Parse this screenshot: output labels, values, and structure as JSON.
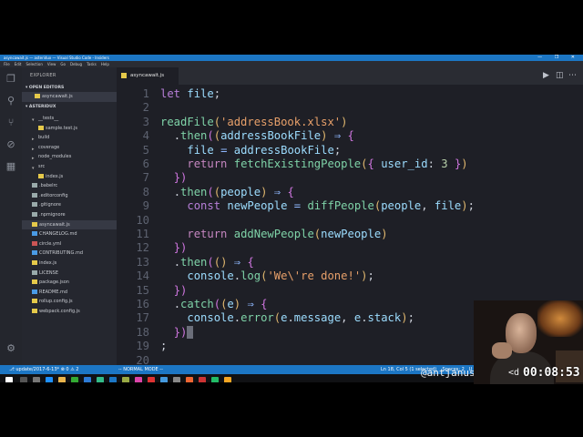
{
  "window": {
    "title": "asyncawait.js — asteridux — Visual Studio Code - Insiders",
    "controls": "— ❐ ✕"
  },
  "menu": [
    "File",
    "Edit",
    "Selection",
    "View",
    "Go",
    "Debug",
    "Tasks",
    "Help"
  ],
  "sidebar": {
    "title": "EXPLORER",
    "open_editors_label": "OPEN EDITORS",
    "open_editors": [
      "asyncawait.js"
    ],
    "project_label": "ASTERIDUX",
    "tree": [
      {
        "label": "__tests__",
        "depth": 1,
        "type": "folder",
        "open": true
      },
      {
        "label": "sample.test.js",
        "depth": 2,
        "type": "file"
      },
      {
        "label": "build",
        "depth": 1,
        "type": "folder",
        "open": false
      },
      {
        "label": "coverage",
        "depth": 1,
        "type": "folder",
        "open": false
      },
      {
        "label": "node_modules",
        "depth": 1,
        "type": "folder",
        "open": false
      },
      {
        "label": "src",
        "depth": 1,
        "type": "folder",
        "open": true
      },
      {
        "label": "index.js",
        "depth": 2,
        "type": "file"
      },
      {
        "label": ".babelrc",
        "depth": 1,
        "type": "file"
      },
      {
        "label": ".editorconfig",
        "depth": 1,
        "type": "file"
      },
      {
        "label": ".gitignore",
        "depth": 1,
        "type": "file"
      },
      {
        "label": ".npmignore",
        "depth": 1,
        "type": "file"
      },
      {
        "label": "asyncawait.js",
        "depth": 1,
        "type": "file",
        "selected": true
      },
      {
        "label": "CHANGELOG.md",
        "depth": 1,
        "type": "file"
      },
      {
        "label": "circle.yml",
        "depth": 1,
        "type": "file"
      },
      {
        "label": "CONTRIBUTING.md",
        "depth": 1,
        "type": "file"
      },
      {
        "label": "index.js",
        "depth": 1,
        "type": "file"
      },
      {
        "label": "LICENSE",
        "depth": 1,
        "type": "file"
      },
      {
        "label": "package.json",
        "depth": 1,
        "type": "file"
      },
      {
        "label": "README.md",
        "depth": 1,
        "type": "file"
      },
      {
        "label": "rollup.config.js",
        "depth": 1,
        "type": "file"
      },
      {
        "label": "webpack.config.js",
        "depth": 1,
        "type": "file"
      }
    ]
  },
  "editor": {
    "tab_label": "asyncawait.js",
    "lines": [
      {
        "n": "1",
        "html": "<span class='k2'>let</span> <span class='v'>file</span><span class='p'>;</span>"
      },
      {
        "n": "2",
        "html": ""
      },
      {
        "n": "3",
        "html": "<span class='fn'>readFile</span><span class='br'>(</span><span class='s'>'addressBook.xlsx'</span><span class='br'>)</span>"
      },
      {
        "n": "4",
        "html": "  <span class='p'>.</span><span class='fn'>then</span><span class='br2'>(</span><span class='br'>(</span><span class='v'>addressBookFile</span><span class='br'>)</span> <span class='op'>⇒</span> <span class='br2'>{</span>"
      },
      {
        "n": "5",
        "html": "    <span class='v'>file</span> <span class='op'>=</span> <span class='v'>addressBookFile</span><span class='p'>;</span>"
      },
      {
        "n": "6",
        "html": "    <span class='k'>return</span> <span class='fn'>fetchExistingPeople</span><span class='br'>(</span><span class='br2'>{</span> <span class='v'>user_id</span><span class='p'>:</span> <span class='n'>3</span> <span class='br2'>}</span><span class='br'>)</span>"
      },
      {
        "n": "7",
        "html": "  <span class='br2'>})</span>"
      },
      {
        "n": "8",
        "html": "  <span class='p'>.</span><span class='fn'>then</span><span class='br2'>(</span><span class='br'>(</span><span class='v'>people</span><span class='br'>)</span> <span class='op'>⇒</span> <span class='br2'>{</span>"
      },
      {
        "n": "9",
        "html": "    <span class='k2'>const</span> <span class='v'>newPeople</span> <span class='op'>=</span> <span class='fn'>diffPeople</span><span class='br'>(</span><span class='v'>people</span><span class='p'>,</span> <span class='v'>file</span><span class='br'>)</span><span class='p'>;</span>"
      },
      {
        "n": "10",
        "html": ""
      },
      {
        "n": "11",
        "html": "    <span class='k'>return</span> <span class='fn'>addNewPeople</span><span class='br'>(</span><span class='v'>newPeople</span><span class='br'>)</span>"
      },
      {
        "n": "12",
        "html": "  <span class='br2'>})</span>"
      },
      {
        "n": "13",
        "html": "  <span class='p'>.</span><span class='fn'>then</span><span class='br2'>(</span><span class='br'>()</span> <span class='op'>⇒</span> <span class='br2'>{</span>"
      },
      {
        "n": "14",
        "html": "    <span class='v'>console</span><span class='p'>.</span><span class='fn'>log</span><span class='br'>(</span><span class='s'>'We\\'re done!'</span><span class='br'>)</span><span class='p'>;</span>"
      },
      {
        "n": "15",
        "html": "  <span class='br2'>})</span>"
      },
      {
        "n": "16",
        "html": "  <span class='p'>.</span><span class='fn'>catch</span><span class='br2'>(</span><span class='br'>(</span><span class='v'>e</span><span class='br'>)</span> <span class='op'>⇒</span> <span class='br2'>{</span>"
      },
      {
        "n": "17",
        "html": "    <span class='v'>console</span><span class='p'>.</span><span class='fn'>error</span><span class='br'>(</span><span class='v'>e</span><span class='p'>.</span><span class='v'>message</span><span class='p'>,</span> <span class='v'>e</span><span class='p'>.</span><span class='v'>stack</span><span class='br'>)</span><span class='p'>;</span>"
      },
      {
        "n": "18",
        "html": "  <span class='br2'>})</span><span class='cursor'></span>"
      },
      {
        "n": "19",
        "html": "<span class='p'>;</span>"
      },
      {
        "n": "20",
        "html": ""
      }
    ]
  },
  "statusbar": {
    "branch": "update/2017-6-13*",
    "problems": "⊗ 0  ⚠ 2",
    "mode": "-- NORMAL MODE --",
    "position": "Ln 18, Col 5 (1 selected)",
    "spaces": "Spaces: 2",
    "encoding": "U"
  },
  "overlay": {
    "handle": "@antjanus",
    "tag": "<d",
    "timer": "00:08:53"
  },
  "colors": {
    "accent": "#1c76c4",
    "editor_bg": "#1e1f26",
    "sidebar_bg": "#25272f"
  }
}
